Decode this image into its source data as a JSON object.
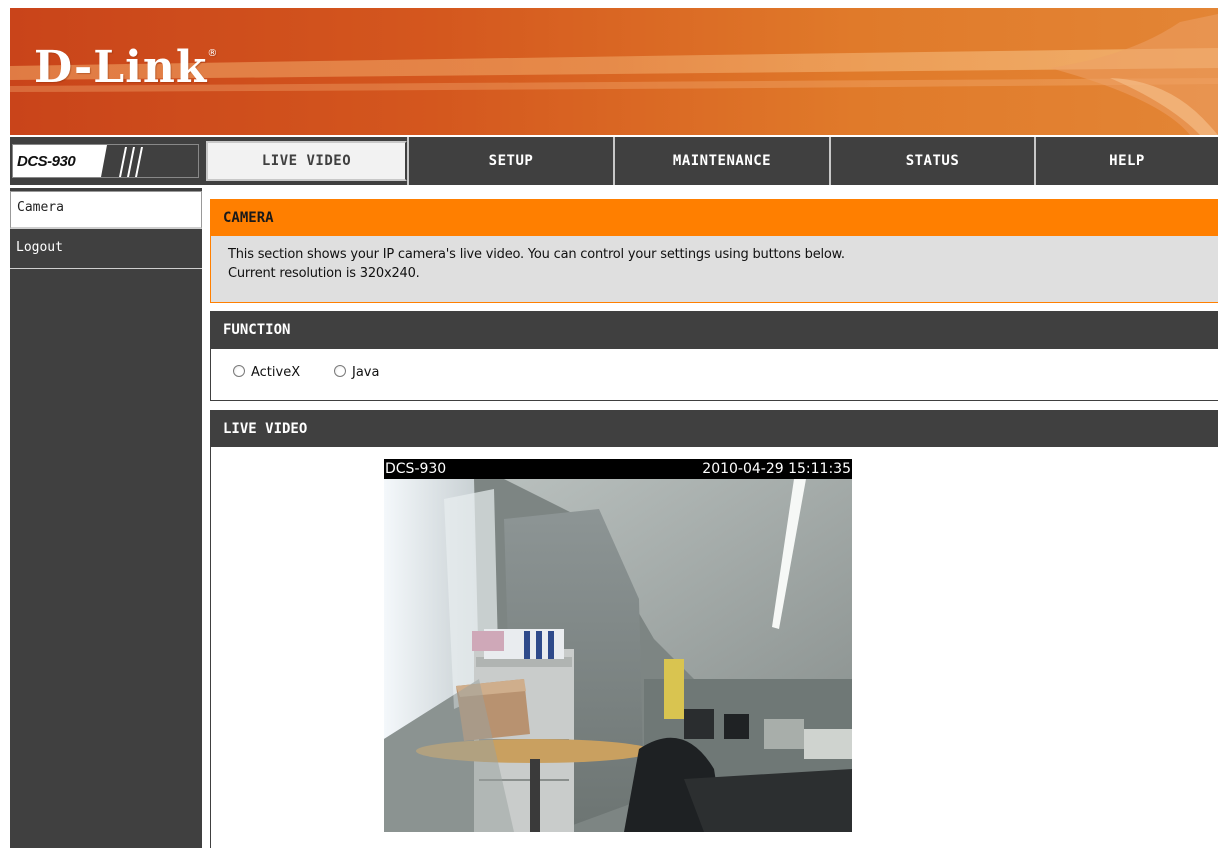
{
  "brand": {
    "logo_text": "D-Link",
    "registered_mark": "®",
    "model": "DCS-930"
  },
  "nav": {
    "tabs": [
      {
        "label": "LIVE VIDEO",
        "active": true
      },
      {
        "label": "SETUP",
        "active": false
      },
      {
        "label": "MAINTENANCE",
        "active": false
      },
      {
        "label": "STATUS",
        "active": false
      },
      {
        "label": "HELP",
        "active": false
      }
    ]
  },
  "sidebar": {
    "items": [
      {
        "label": "Camera",
        "active": true
      },
      {
        "label": "Logout",
        "active": false
      }
    ]
  },
  "camera_section": {
    "title": "CAMERA",
    "description_line1": "This section shows your IP camera's live video. You can control your settings using buttons below.",
    "description_line2": "Current resolution is 320x240."
  },
  "function_section": {
    "title": "FUNCTION",
    "options": [
      {
        "label": "ActiveX",
        "selected": false
      },
      {
        "label": "Java",
        "selected": false
      }
    ]
  },
  "live_video_section": {
    "title": "LIVE VIDEO",
    "camera_name": "DCS-930",
    "timestamp": "2010-04-29 15:11:35"
  },
  "colors": {
    "accent_orange": "#ff7f00",
    "nav_dark": "#404040",
    "panel_grey": "#dfdfdf"
  }
}
